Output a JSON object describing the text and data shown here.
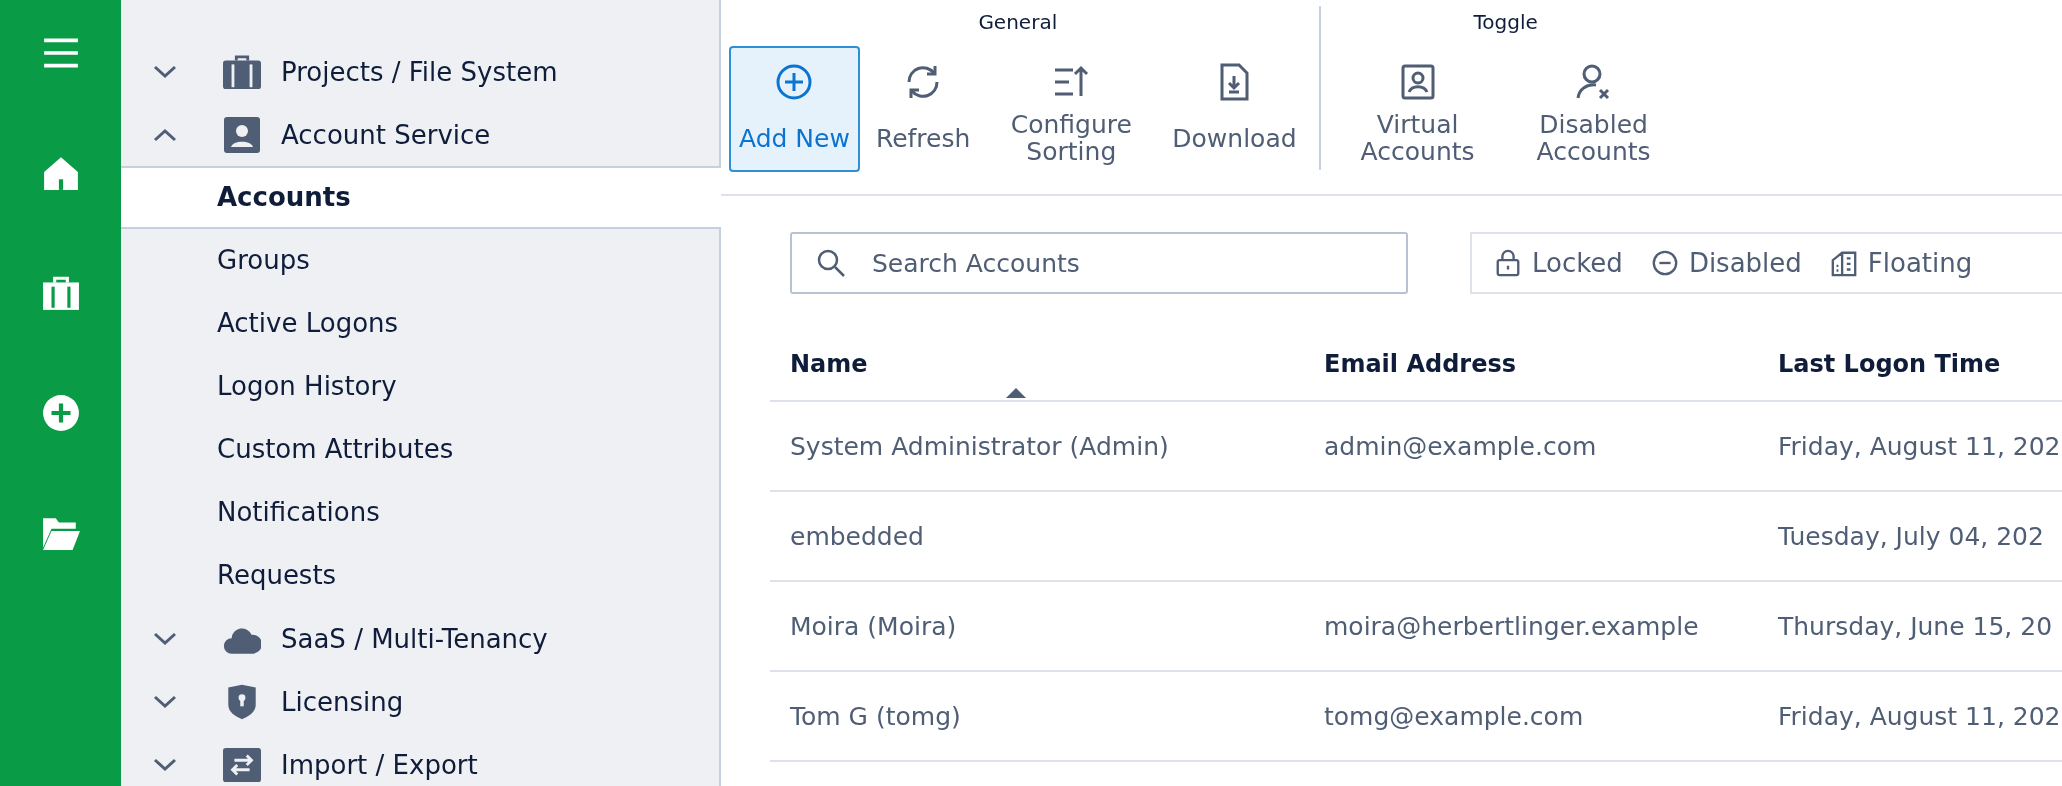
{
  "sidebar": {
    "items": [
      {
        "label": "Projects / File System",
        "expanded": false
      },
      {
        "label": "Account Service",
        "expanded": true,
        "children": [
          {
            "label": "Accounts",
            "selected": true
          },
          {
            "label": "Groups",
            "selected": false
          },
          {
            "label": "Active Logons",
            "selected": false
          },
          {
            "label": "Logon History",
            "selected": false
          },
          {
            "label": "Custom Attributes",
            "selected": false
          },
          {
            "label": "Notifications",
            "selected": false
          },
          {
            "label": "Requests",
            "selected": false
          }
        ]
      },
      {
        "label": "SaaS / Multi-Tenancy",
        "expanded": false
      },
      {
        "label": "Licensing",
        "expanded": false
      },
      {
        "label": "Import / Export",
        "expanded": false
      }
    ]
  },
  "toolbar": {
    "groups": [
      {
        "title": "General",
        "buttons": [
          {
            "label": "Add New",
            "active": true
          },
          {
            "label": "Refresh",
            "active": false
          },
          {
            "label": "Configure Sorting",
            "active": false
          },
          {
            "label": "Download",
            "active": false
          }
        ]
      },
      {
        "title": "Toggle",
        "buttons": [
          {
            "label": "Virtual Accounts",
            "active": false
          },
          {
            "label": "Disabled Accounts",
            "active": false
          }
        ]
      }
    ]
  },
  "search": {
    "placeholder": "Search Accounts"
  },
  "filters": [
    {
      "label": "Locked"
    },
    {
      "label": "Disabled"
    },
    {
      "label": "Floating"
    }
  ],
  "table": {
    "columns": [
      {
        "label": "Name",
        "sorted": true
      },
      {
        "label": "Email Address",
        "sorted": false
      },
      {
        "label": "Last Logon Time",
        "sorted": false
      }
    ],
    "rows": [
      [
        "System Administrator (Admin)",
        "admin@example.com",
        "Friday, August 11, 202"
      ],
      [
        "embedded",
        "",
        "Tuesday, July 04, 202"
      ],
      [
        "Moira (Moira)",
        "moira@herbertlinger.example",
        "Thursday, June 15, 20"
      ],
      [
        "Tom G (tomg)",
        "tomg@example.com",
        "Friday, August 11, 202"
      ]
    ]
  }
}
